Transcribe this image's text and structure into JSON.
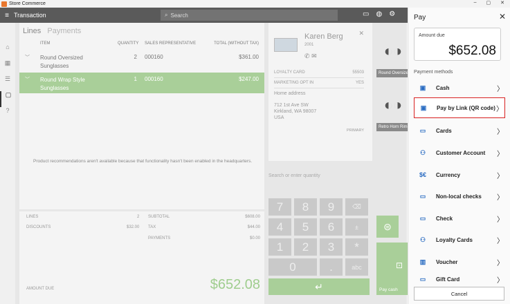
{
  "window": {
    "title": "Store Commerce",
    "controls": [
      "–",
      "▢",
      "✕"
    ]
  },
  "appbar": {
    "title": "Transaction",
    "search_placeholder": "Search"
  },
  "lines": {
    "tab_active": "Lines",
    "tab_inactive": "Payments",
    "columns": {
      "item": "ITEM",
      "qty": "QUANTITY",
      "rep": "SALES REPRESENTATIVE",
      "total": "TOTAL (WITHOUT TAX)"
    },
    "rows": [
      {
        "item": "Round Oversized Sunglasses",
        "qty": "2",
        "rep": "000160",
        "total": "$361.00"
      },
      {
        "item": "Round Wrap Style Sunglasses",
        "qty": "1",
        "rep": "000160",
        "total": "$247.00"
      }
    ],
    "recommendation_msg": "Product recommendations aren't available because that functionality hasn't been enabled in the headquarters."
  },
  "customer": {
    "name": "Karen Berg",
    "id": "2001",
    "loyalty_label": "LOYALTY CARD",
    "loyalty_value": "55503",
    "marketing_label": "MARKETING OPT IN",
    "marketing_value": "YES",
    "home_label": "Home address",
    "address_line1": "712 1st Ave SW",
    "address_line2": "Kirkland, WA 98007",
    "address_line3": "USA",
    "primary": "PRIMARY"
  },
  "search_qty_placeholder": "Search or enter quantity",
  "totals": {
    "lines_label": "LINES",
    "lines_value": "2",
    "discounts_label": "DISCOUNTS",
    "discounts_value": "$32.00",
    "subtotal_label": "SUBTOTAL",
    "subtotal_value": "$608.00",
    "tax_label": "TAX",
    "tax_value": "$44.00",
    "payments_label": "PAYMENTS",
    "payments_value": "$0.00",
    "amount_due_label": "AMOUNT DUE",
    "amount_due_value": "$652.08"
  },
  "numpad": {
    "k7": "7",
    "k8": "8",
    "k9": "9",
    "k4": "4",
    "k5": "5",
    "k6": "6",
    "k1": "1",
    "k2": "2",
    "k3": "3",
    "k0": "0",
    "dot": ".",
    "pm": "±",
    "mul": "*",
    "abc": "abc",
    "back": "⌫",
    "enter": "↵"
  },
  "products": [
    {
      "name": "Round Oversized Sunglasses"
    },
    {
      "name": "Retro Horn Rimmed Sunglasses"
    }
  ],
  "pay_cash_label": "Pay cash",
  "pay": {
    "title": "Pay",
    "amount_due_label": "Amount due",
    "amount_due": "$652.08",
    "methods_label": "Payment methods",
    "methods": [
      {
        "label": "Cash",
        "icon": "cash-icon"
      },
      {
        "label": "Pay by Link (QR code)",
        "icon": "qr-code-icon"
      },
      {
        "label": "Cards",
        "icon": "card-icon"
      },
      {
        "label": "Customer Account",
        "icon": "customer-account-icon"
      },
      {
        "label": "Currency",
        "icon": "currency-icon"
      },
      {
        "label": "Non-local checks",
        "icon": "check-icon"
      },
      {
        "label": "Check",
        "icon": "check-icon"
      },
      {
        "label": "Loyalty Cards",
        "icon": "loyalty-card-icon"
      },
      {
        "label": "Voucher",
        "icon": "voucher-icon"
      },
      {
        "label": "Gift Card",
        "icon": "gift-card-icon"
      }
    ],
    "cancel_label": "Cancel"
  }
}
